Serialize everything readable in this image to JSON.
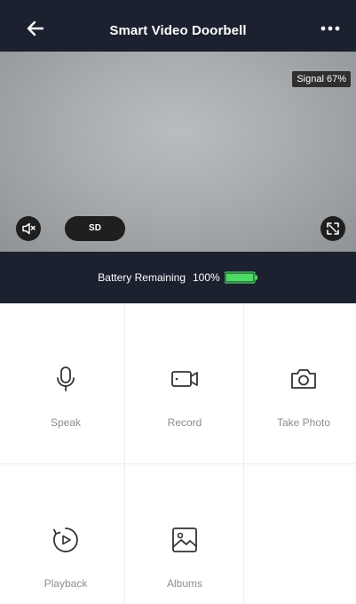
{
  "header": {
    "title": "Smart Video Doorbell",
    "back_icon": "arrow-left-icon",
    "more_icon": "more-dots-icon",
    "background": "#1c2130"
  },
  "video": {
    "signal_label": "Signal 67%",
    "quality_label": "SD",
    "mute_icon": "speaker-mute-icon",
    "fullscreen_icon": "fullscreen-icon"
  },
  "battery": {
    "label": "Battery Remaining",
    "value": "100%",
    "level": 1.0,
    "color": "#4cd964"
  },
  "actions": [
    {
      "label": "Speak",
      "icon": "microphone-icon"
    },
    {
      "label": "Record",
      "icon": "video-camera-icon"
    },
    {
      "label": "Take Photo",
      "icon": "camera-icon"
    },
    {
      "label": "Playback",
      "icon": "playback-icon"
    },
    {
      "label": "Albums",
      "icon": "album-image-icon"
    }
  ]
}
